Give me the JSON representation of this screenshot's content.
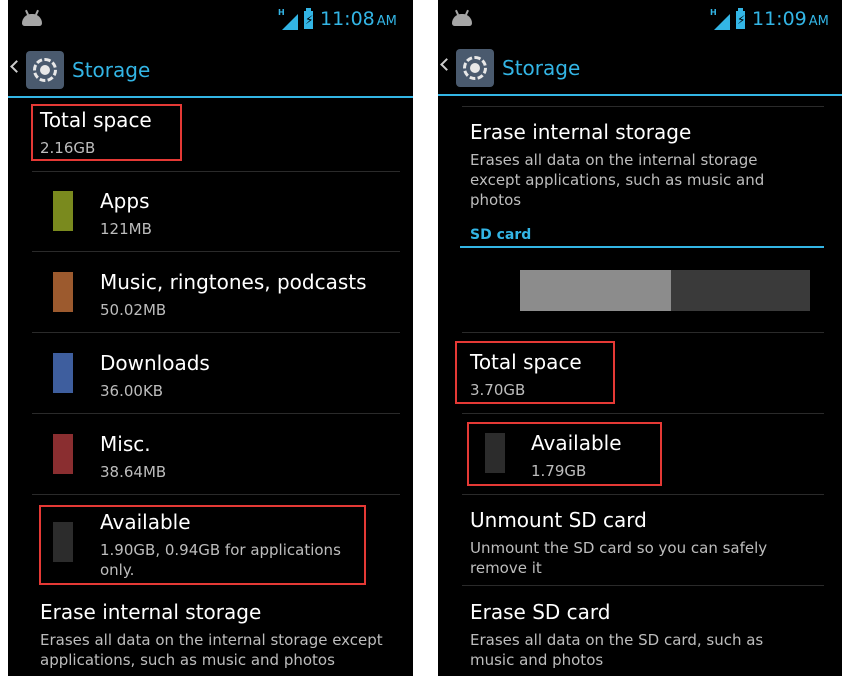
{
  "left": {
    "status": {
      "time": "11:08",
      "ampm": "AM"
    },
    "title": "Storage",
    "total": {
      "title": "Total space",
      "value": "2.16GB"
    },
    "categories": [
      {
        "label": "Apps",
        "value": "121MB",
        "color": "#7a8a1e"
      },
      {
        "label": "Music, ringtones, podcasts",
        "value": "50.02MB",
        "color": "#9c5a2e"
      },
      {
        "label": "Downloads",
        "value": "36.00KB",
        "color": "#3e5e9e"
      },
      {
        "label": "Misc.",
        "value": "38.64MB",
        "color": "#8a2e30"
      },
      {
        "label": "Available",
        "value": "1.90GB, 0.94GB for applications only.",
        "color": "#2c2c2c"
      }
    ],
    "erase": {
      "title": "Erase internal storage",
      "summary": "Erases all data on the internal storage except applications, such as music and photos"
    }
  },
  "right": {
    "status": {
      "time": "11:09",
      "ampm": "AM"
    },
    "title": "Storage",
    "erase_internal": {
      "title": "Erase internal storage",
      "summary": "Erases all data on the internal storage except applications, such as music and photos"
    },
    "sd_header": "SD card",
    "sd_usage_fraction": 0.52,
    "total": {
      "title": "Total space",
      "value": "3.70GB"
    },
    "available": {
      "label": "Available",
      "value": "1.79GB",
      "color": "#2c2c2c"
    },
    "unmount": {
      "title": "Unmount SD card",
      "summary": "Unmount the SD card so you can safely remove it"
    },
    "erase_sd": {
      "title": "Erase SD card",
      "summary": "Erases all data on the SD card, such as music and photos"
    }
  },
  "colors": {
    "accent": "#33b5e5",
    "highlight": "#e53935",
    "background": "#000000"
  }
}
